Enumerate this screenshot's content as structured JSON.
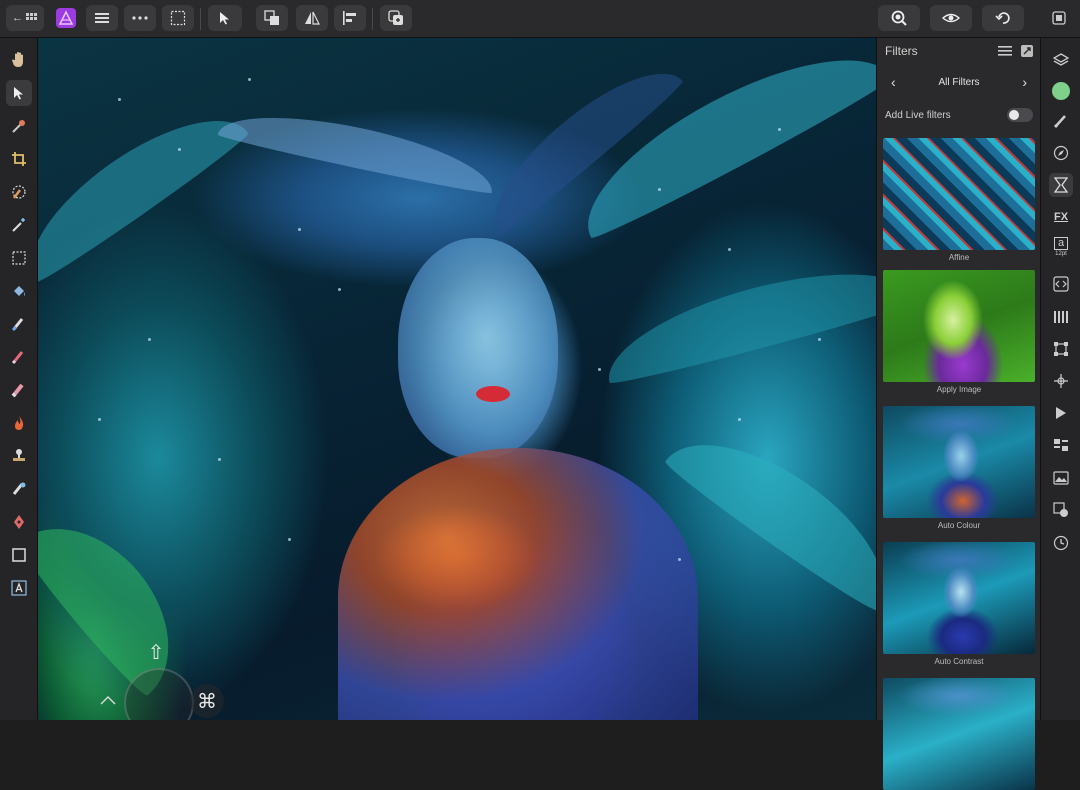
{
  "toolbar": {
    "back_label": "←",
    "icons": [
      "back-grid-icon",
      "photo-persona-icon",
      "menu-icon",
      "more-icon",
      "selection-icon",
      "move-tool-icon",
      "arrange-icon",
      "flip-icon",
      "align-icon",
      "add-layer-icon",
      "zoom-icon",
      "view-icon",
      "history-icon",
      "fullscreen-icon"
    ]
  },
  "tools": [
    "hand-tool",
    "move-tool",
    "color-picker-tool",
    "crop-tool",
    "selection-brush-tool",
    "flood-select-tool",
    "marquee-tool",
    "flood-fill-tool",
    "paint-brush-tool",
    "pixel-tool",
    "erase-tool",
    "dodge-burn-tool",
    "clone-tool",
    "retouch-tool",
    "pen-tool",
    "rectangle-tool",
    "text-tool"
  ],
  "panel": {
    "title": "Filters",
    "nav_label": "All Filters",
    "nav_prev": "‹",
    "nav_next": "›",
    "live_label": "Add Live filters",
    "live_enabled": false,
    "filters": [
      {
        "label": "Affine"
      },
      {
        "label": "Apply Image"
      },
      {
        "label": "Auto Colour"
      },
      {
        "label": "Auto Contrast"
      },
      {
        "label": ""
      }
    ]
  },
  "studio": {
    "icons": [
      "layers-icon",
      "color-icon",
      "brushes-icon",
      "navigator-icon",
      "filters-icon",
      "fx-icon",
      "character-icon",
      "transform-code-icon",
      "channels-icon",
      "transform-icon",
      "snapping-icon",
      "macro-icon",
      "adjustments-icon",
      "stock-icon",
      "assets-icon",
      "history-icon"
    ],
    "character_sub": "12pt",
    "character_label": "a",
    "fx_label": "FX",
    "accent": "#7fd08a"
  },
  "canvas": {
    "overlay_shift": "⇧",
    "overlay_cmd": "⌘"
  }
}
